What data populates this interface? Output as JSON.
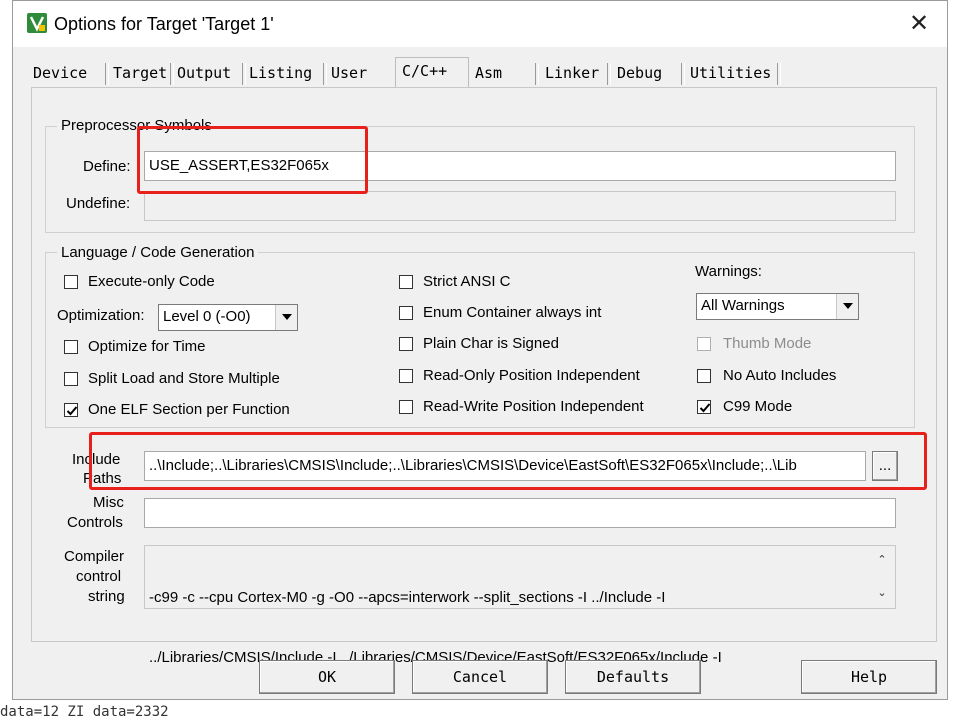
{
  "window": {
    "title": "Options for Target 'Target 1'",
    "close_glyph": "✕"
  },
  "tabs": [
    {
      "label": "Device"
    },
    {
      "label": "Target"
    },
    {
      "label": "Output"
    },
    {
      "label": "Listing"
    },
    {
      "label": "User"
    },
    {
      "label": "C/C++",
      "active": true
    },
    {
      "label": "Asm"
    },
    {
      "label": "Linker"
    },
    {
      "label": "Debug"
    },
    {
      "label": "Utilities"
    }
  ],
  "preprocessor": {
    "group_title": "Preprocessor Symbols",
    "define_label": "Define:",
    "define_value": "USE_ASSERT,ES32F065x",
    "undefine_label": "Undefine:",
    "undefine_value": ""
  },
  "language": {
    "group_title": "Language / Code Generation",
    "execute_only": {
      "label": "Execute-only Code",
      "checked": false
    },
    "optimization_label": "Optimization:",
    "optimization_value": "Level 0 (-O0)",
    "optimize_time": {
      "label": "Optimize for Time",
      "checked": false
    },
    "split_load": {
      "label": "Split Load and Store Multiple",
      "checked": false
    },
    "one_elf": {
      "label": "One ELF Section per Function",
      "checked": true
    },
    "strict_ansi": {
      "label": "Strict ANSI C",
      "checked": false
    },
    "enum_container": {
      "label": "Enum Container always int",
      "checked": false
    },
    "plain_char": {
      "label": "Plain Char is Signed",
      "checked": false
    },
    "ro_position": {
      "label": "Read-Only Position Independent",
      "checked": false
    },
    "rw_position": {
      "label": "Read-Write Position Independent",
      "checked": false
    },
    "warnings_label": "Warnings:",
    "warnings_value": "All Warnings",
    "thumb_mode": {
      "label": "Thumb Mode",
      "checked": false,
      "disabled": true
    },
    "no_auto_includes": {
      "label": "No Auto Includes",
      "checked": false
    },
    "c99_mode": {
      "label": "C99 Mode",
      "checked": true
    }
  },
  "include_paths": {
    "label_line1": "Include",
    "label_line2": "Paths",
    "value": "..\\Include;..\\Libraries\\CMSIS\\Include;..\\Libraries\\CMSIS\\Device\\EastSoft\\ES32F065x\\Include;..\\Lib",
    "browse_label": "..."
  },
  "misc_controls": {
    "label_line1": "Misc",
    "label_line2": "Controls",
    "value": ""
  },
  "compiler_control": {
    "label_line1": "Compiler",
    "label_line2": "control",
    "label_line3": "string",
    "line1": "-c99 -c --cpu Cortex-M0 -g -O0 --apcs=interwork --split_sections -I ../Include -I",
    "line2": "../Libraries/CMSIS/Include -I ../Libraries/CMSIS/Device/EastSoft/ES32F065x/Include -I"
  },
  "buttons": {
    "ok": "OK",
    "cancel": "Cancel",
    "defaults": "Defaults",
    "help": "Help"
  },
  "background": {
    "bottom_text": "data=12 ZI data=2332"
  },
  "colors": {
    "highlight_box": "#e8201c",
    "app_icon": "#2e8b3a"
  }
}
